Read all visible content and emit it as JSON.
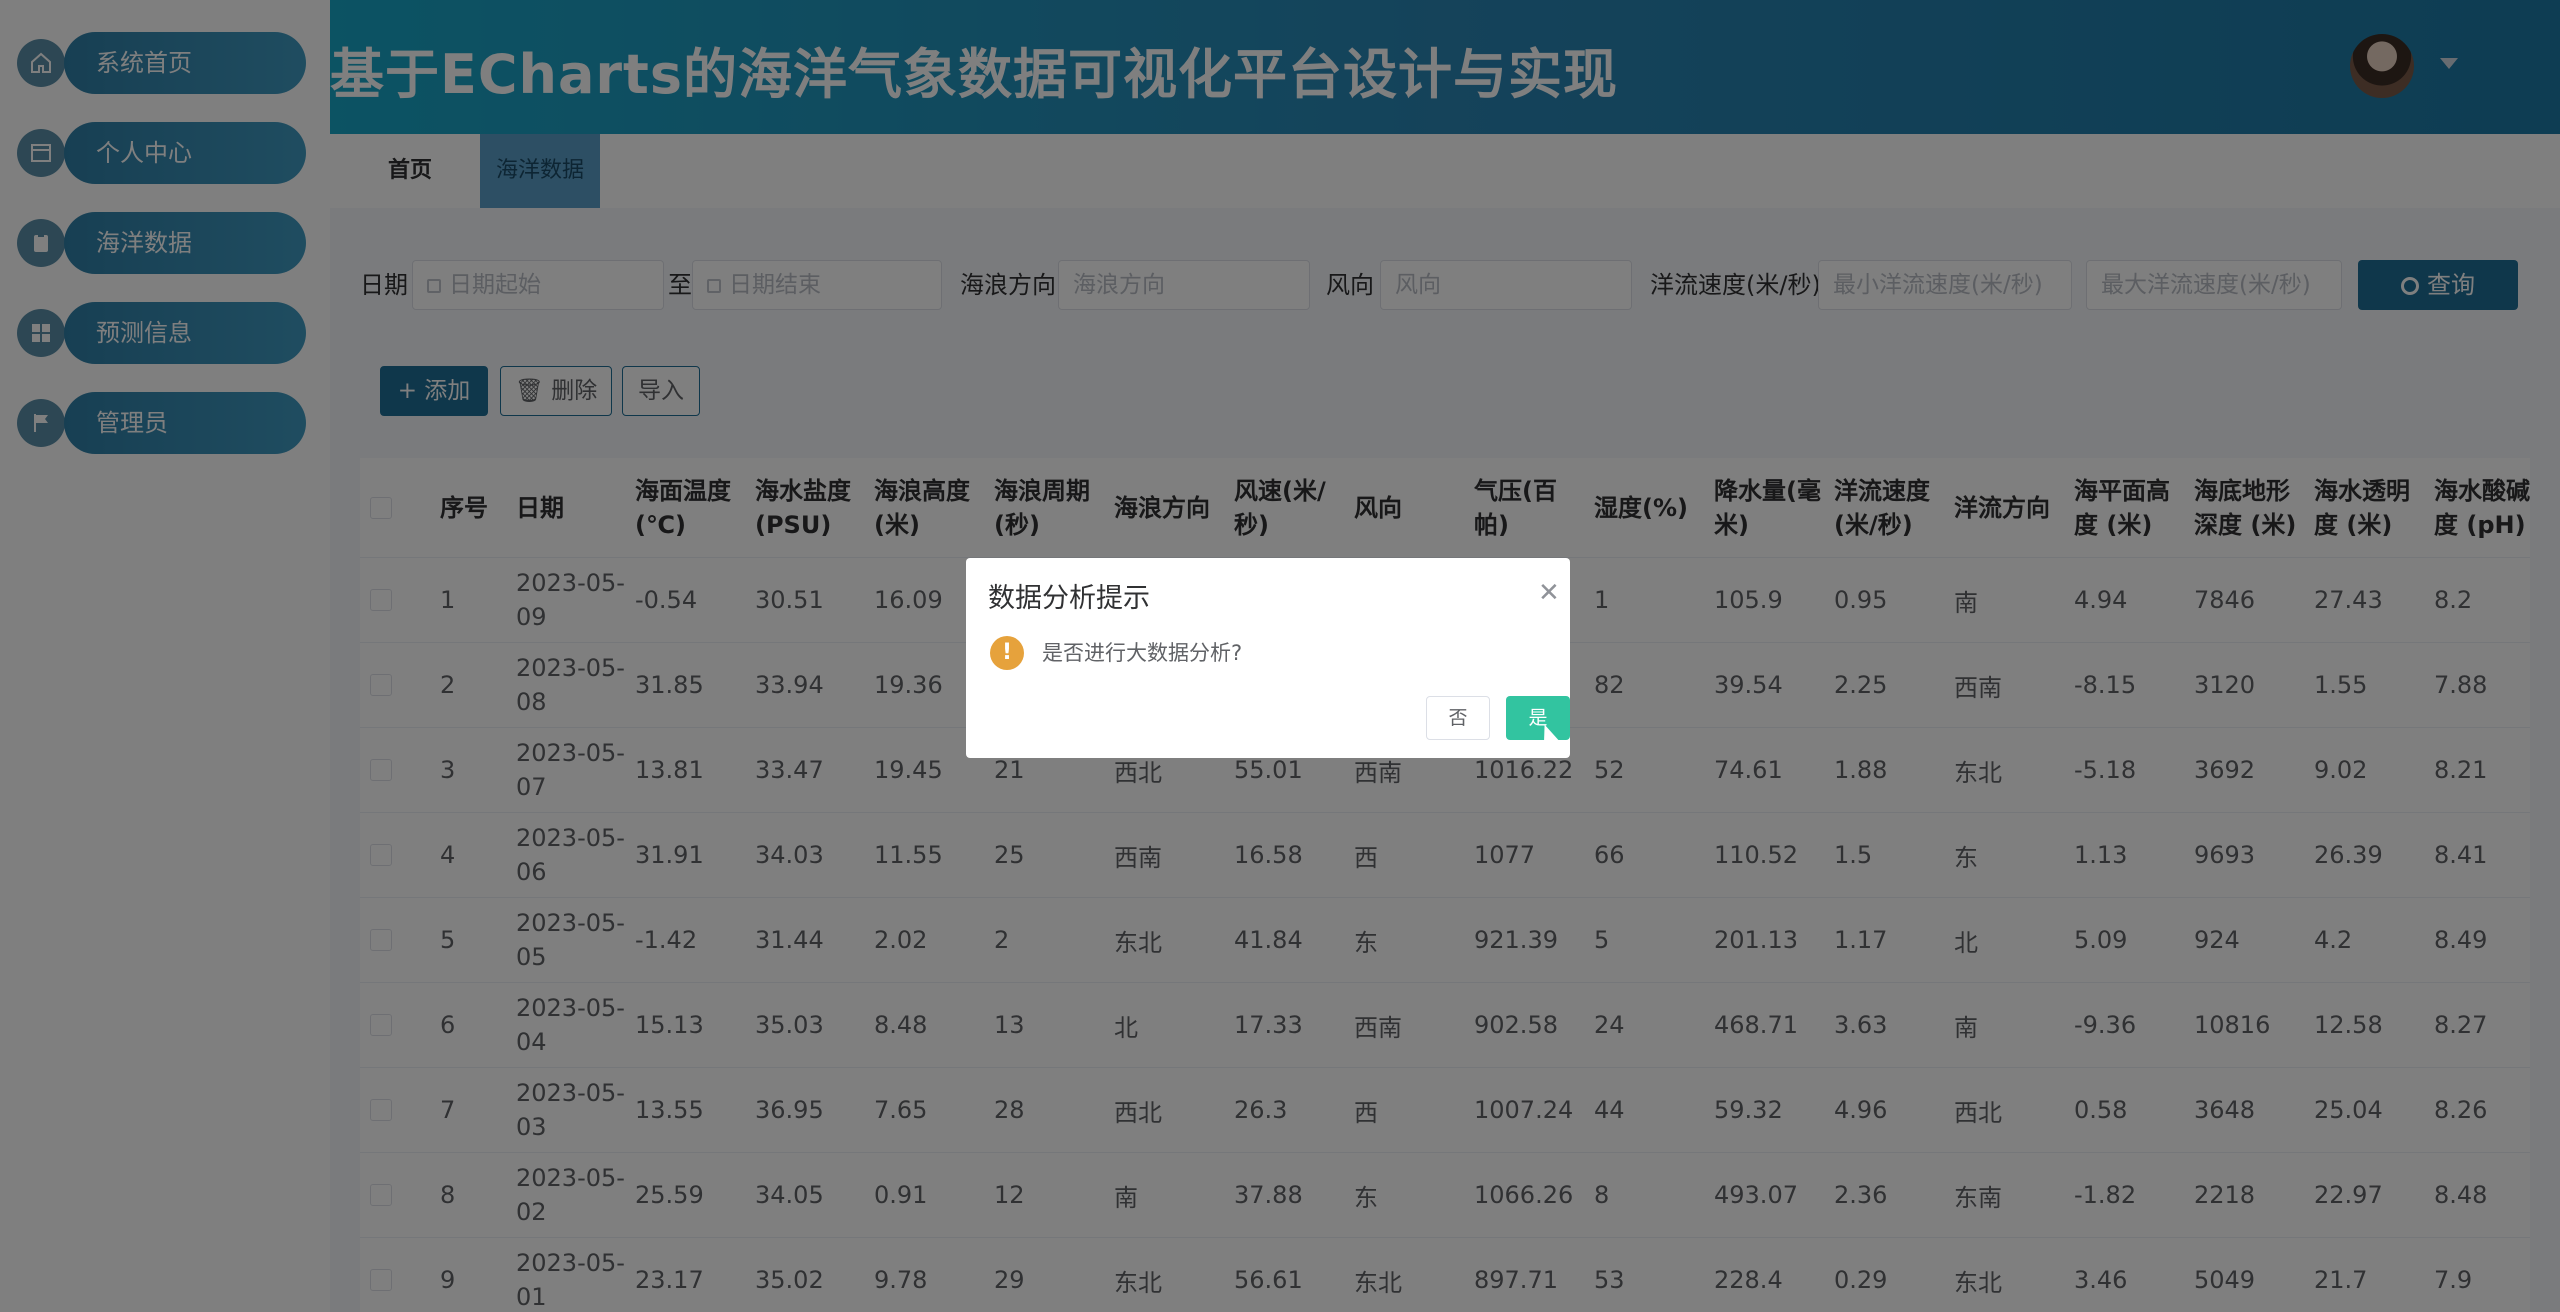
{
  "sidebar": {
    "items": [
      {
        "label": "系统首页",
        "icon": "home-icon"
      },
      {
        "label": "个人中心",
        "icon": "profile-card-icon"
      },
      {
        "label": "海洋数据",
        "icon": "clipboard-icon"
      },
      {
        "label": "预测信息",
        "icon": "grid-icon"
      },
      {
        "label": "管理员",
        "icon": "flag-icon"
      }
    ]
  },
  "header": {
    "title": "基于ECharts的海洋气象数据可视化平台设计与实现"
  },
  "tabs": {
    "home": "首页",
    "active": "海洋数据"
  },
  "filters": {
    "date_label": "日期",
    "date_start_placeholder": "日期起始",
    "to_label": "至",
    "date_end_placeholder": "日期结束",
    "wave_dir_label": "海浪方向",
    "wave_dir_placeholder": "海浪方向",
    "wind_dir_label": "风向",
    "wind_dir_placeholder": "风向",
    "current_speed_label": "洋流速度(米/秒)",
    "min_current_placeholder": "最小洋流速度(米/秒)",
    "max_current_placeholder": "最大洋流速度(米/秒)",
    "query_label": "查询"
  },
  "actions": {
    "add_label": "+ 添加",
    "delete_label": "删除",
    "import_label": "导入"
  },
  "table": {
    "headers": [
      "序号",
      "日期",
      "海面温度 (℃)",
      "海水盐度(PSU)",
      "海浪高度 (米)",
      "海浪周期 (秒)",
      "海浪方向",
      "风速(米/秒)",
      "风向",
      "气压(百帕)",
      "湿度(%)",
      "降水量(毫米)",
      "洋流速度(米/秒)",
      "洋流方向",
      "海平面高度 (米)",
      "海底地形深度 (米)",
      "海水透明度 (米)",
      "海水酸碱度 (pH)"
    ],
    "rows": [
      [
        "1",
        "2023-05-09",
        "-0.54",
        "30.51",
        "16.09",
        "",
        "",
        "",
        "",
        "",
        "1",
        "105.9",
        "0.95",
        "南",
        "4.94",
        "7846",
        "27.43",
        "8.2"
      ],
      [
        "2",
        "2023-05-08",
        "31.85",
        "33.94",
        "19.36",
        "",
        "",
        "",
        "",
        "",
        "82",
        "39.54",
        "2.25",
        "西南",
        "-8.15",
        "3120",
        "1.55",
        "7.88"
      ],
      [
        "3",
        "2023-05-07",
        "13.81",
        "33.47",
        "19.45",
        "21",
        "西北",
        "55.01",
        "西南",
        "1016.22",
        "52",
        "74.61",
        "1.88",
        "东北",
        "-5.18",
        "3692",
        "9.02",
        "8.21"
      ],
      [
        "4",
        "2023-05-06",
        "31.91",
        "34.03",
        "11.55",
        "25",
        "西南",
        "16.58",
        "西",
        "1077",
        "66",
        "110.52",
        "1.5",
        "东",
        "1.13",
        "9693",
        "26.39",
        "8.41"
      ],
      [
        "5",
        "2023-05-05",
        "-1.42",
        "31.44",
        "2.02",
        "2",
        "东北",
        "41.84",
        "东",
        "921.39",
        "5",
        "201.13",
        "1.17",
        "北",
        "5.09",
        "924",
        "4.2",
        "8.49"
      ],
      [
        "6",
        "2023-05-04",
        "15.13",
        "35.03",
        "8.48",
        "13",
        "北",
        "17.33",
        "西南",
        "902.58",
        "24",
        "468.71",
        "3.63",
        "南",
        "-9.36",
        "10816",
        "12.58",
        "8.27"
      ],
      [
        "7",
        "2023-05-03",
        "13.55",
        "36.95",
        "7.65",
        "28",
        "西北",
        "26.3",
        "西",
        "1007.24",
        "44",
        "59.32",
        "4.96",
        "西北",
        "0.58",
        "3648",
        "25.04",
        "8.26"
      ],
      [
        "8",
        "2023-05-02",
        "25.59",
        "34.05",
        "0.91",
        "12",
        "南",
        "37.88",
        "东",
        "1066.26",
        "8",
        "493.07",
        "2.36",
        "东南",
        "-1.82",
        "2218",
        "22.97",
        "8.48"
      ],
      [
        "9",
        "2023-05-01",
        "23.17",
        "35.02",
        "9.78",
        "29",
        "东北",
        "56.61",
        "东北",
        "897.71",
        "53",
        "228.4",
        "0.29",
        "东北",
        "3.46",
        "5049",
        "21.7",
        "7.9"
      ]
    ]
  },
  "dialog": {
    "title": "数据分析提示",
    "message": "是否进行大数据分析?",
    "no_label": "否",
    "yes_label": "是"
  },
  "colors": {
    "accent": "#1f6f96",
    "confirm": "#32c4a0",
    "warning": "#e6a23c"
  }
}
